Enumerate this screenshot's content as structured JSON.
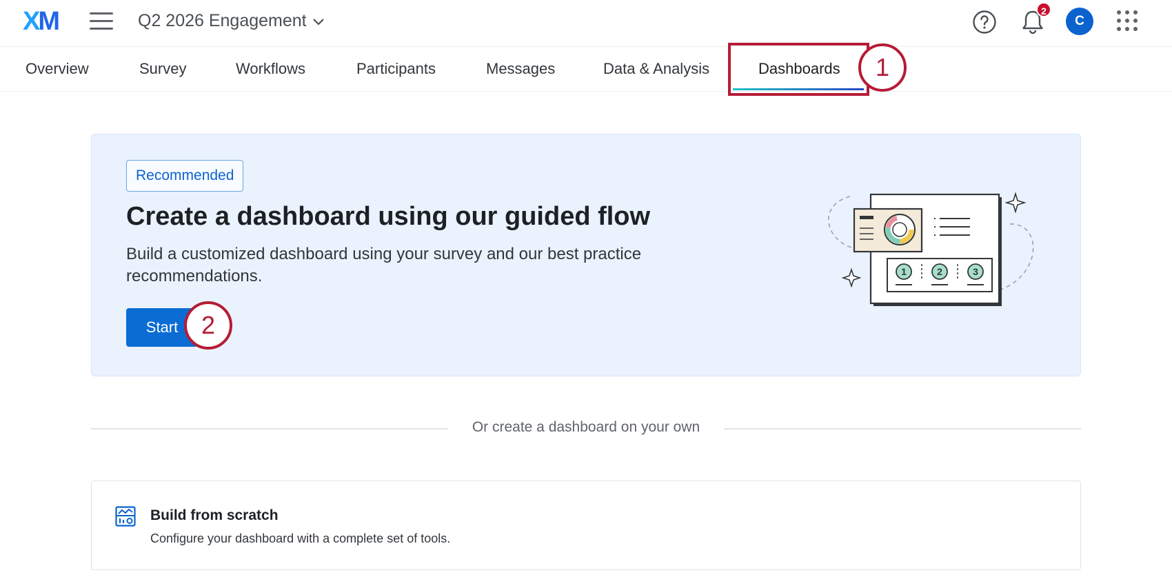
{
  "header": {
    "logo_x": "X",
    "logo_m": "M",
    "project_title": "Q2 2026 Engagement",
    "notification_count": "2",
    "avatar_initial": "C",
    "icons": [
      "menu-icon",
      "chevron-down-icon",
      "help-icon",
      "bell-icon",
      "apps-grid-icon"
    ]
  },
  "tabs": [
    {
      "label": "Overview"
    },
    {
      "label": "Survey"
    },
    {
      "label": "Workflows"
    },
    {
      "label": "Participants"
    },
    {
      "label": "Messages"
    },
    {
      "label": "Data & Analysis"
    },
    {
      "label": "Dashboards",
      "active": true
    }
  ],
  "callouts": [
    "1",
    "2"
  ],
  "hero": {
    "badge": "Recommended",
    "title": "Create a dashboard using our guided flow",
    "description": "Build a customized dashboard using your survey and our best practice recommendations.",
    "start_label": "Start",
    "illustration_steps": [
      "1",
      "2",
      "3"
    ]
  },
  "divider_text": "Or create a dashboard on your own",
  "scratch": {
    "title": "Build from scratch",
    "description": "Configure your dashboard with a complete set of tools."
  },
  "colors": {
    "primary": "#0b6cd4",
    "callout": "#b51c36",
    "hero_bg": "#eaf2fd"
  }
}
